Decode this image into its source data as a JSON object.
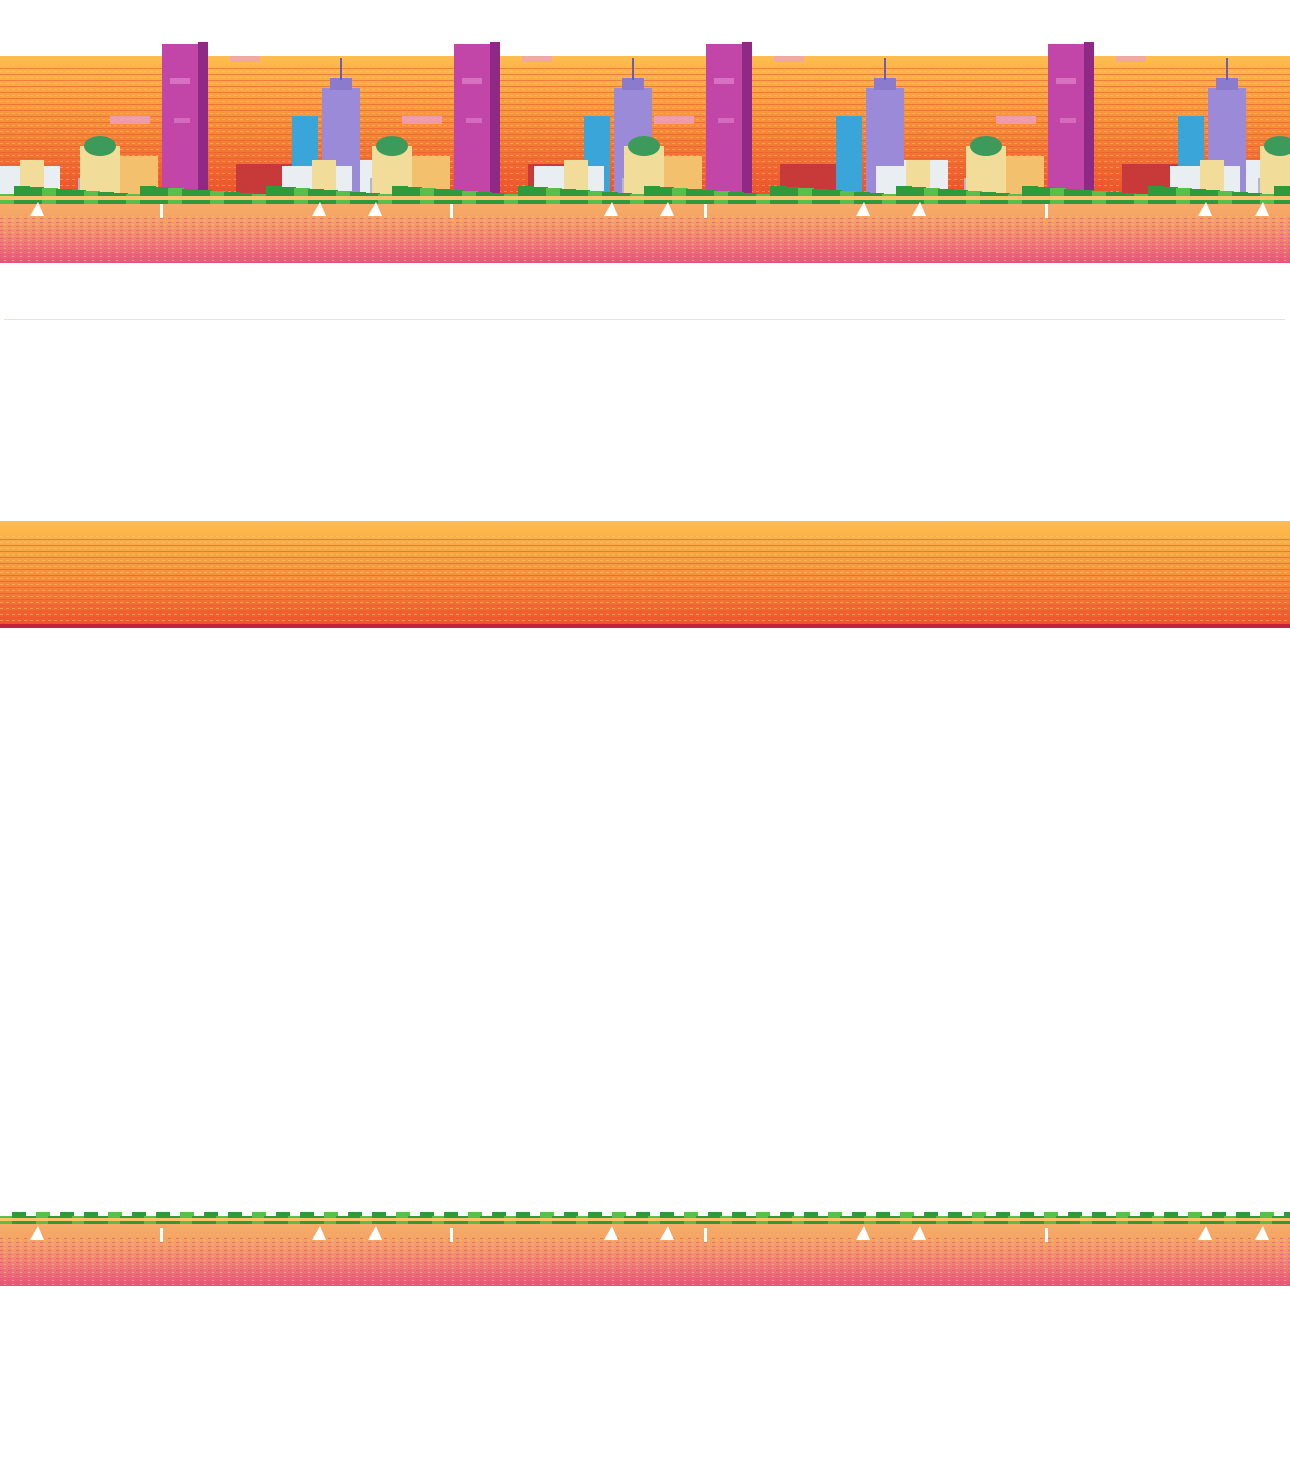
{
  "scene": {
    "palette": {
      "sky_top": "#fdbe4e",
      "sky_mid": "#f7923b",
      "sky_bottom": "#ef4f2c",
      "water_light": "#f4a163",
      "water_pink": "#f07a78",
      "water_deep": "#e8547a",
      "foliage": "#2e9a3a",
      "foliage_light": "#58c04a",
      "tower_magenta": "#c246a8",
      "tower_magenta_dark": "#8e2a86",
      "tower_purple": "#9b8ad8",
      "tower_blue": "#3aa5d8",
      "dome_green": "#3c9a5a",
      "building_cream": "#f1dc9a",
      "building_red": "#c83a3a",
      "building_white": "#e8eef2",
      "divider": "#d8ead8"
    },
    "layers": [
      {
        "name": "skyline-strip",
        "tiles": 4,
        "tile_width": 292
      },
      {
        "name": "sky-gradient-strip"
      },
      {
        "name": "riverbank-strip",
        "tiles": 4,
        "tile_width": 292
      }
    ]
  }
}
